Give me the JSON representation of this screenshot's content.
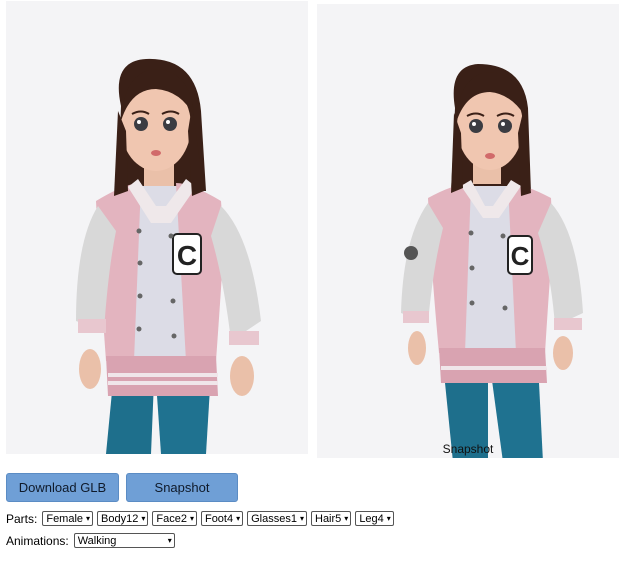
{
  "viewer": {
    "snapshot_caption": "Snapshot"
  },
  "toolbar": {
    "download_label": "Download GLB",
    "snapshot_label": "Snapshot"
  },
  "parts": {
    "label": "Parts:",
    "selects": [
      {
        "name": "gender",
        "value": "Female"
      },
      {
        "name": "body",
        "value": "Body12"
      },
      {
        "name": "face",
        "value": "Face2"
      },
      {
        "name": "foot",
        "value": "Foot4"
      },
      {
        "name": "glasses",
        "value": "Glasses1"
      },
      {
        "name": "hair",
        "value": "Hair5"
      },
      {
        "name": "leg",
        "value": "Leg4"
      }
    ]
  },
  "animations": {
    "label": "Animations:",
    "value": "Walking"
  },
  "colors": {
    "button_bg": "#6f9fd6",
    "viewport_bg": "#f4f4f6",
    "jacket": "#e3b4bf",
    "sleeve": "#d8d8d8",
    "hair": "#3a2017",
    "jeans": "#1e6f8c"
  }
}
